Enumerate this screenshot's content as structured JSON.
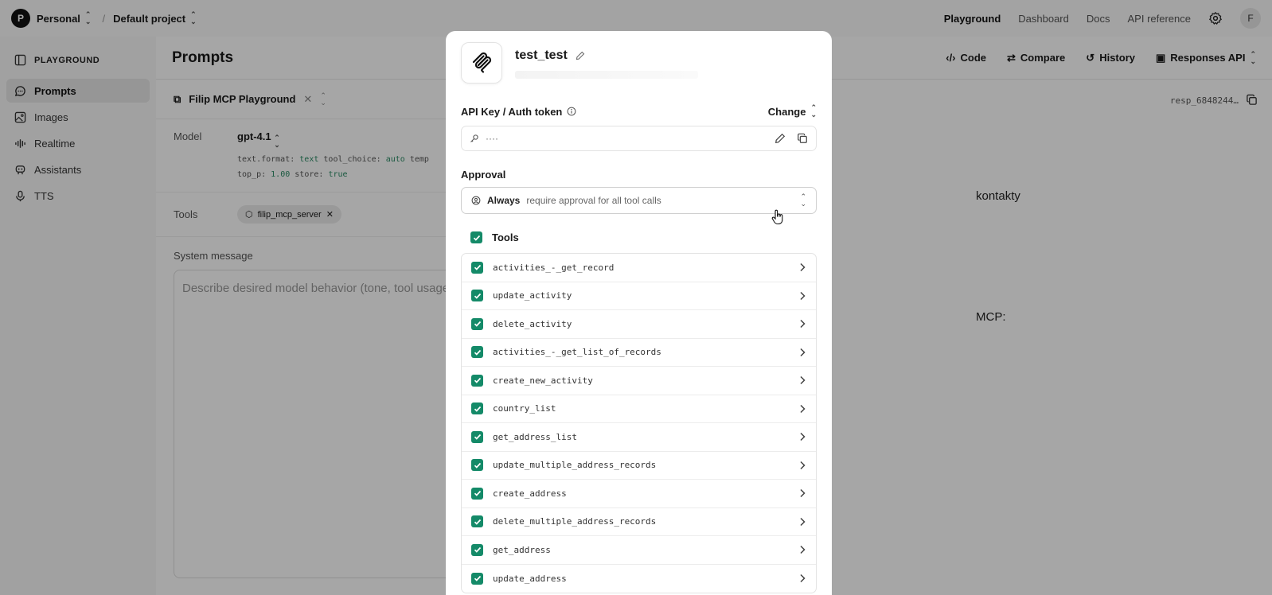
{
  "topbar": {
    "org_initial": "P",
    "org": "Personal",
    "project": "Default project",
    "nav": [
      "Playground",
      "Dashboard",
      "Docs",
      "API reference"
    ],
    "user_initial": "F"
  },
  "sidebar": {
    "section": "PLAYGROUND",
    "items": [
      {
        "label": "Prompts",
        "icon": "chat-bubble-icon"
      },
      {
        "label": "Images",
        "icon": "image-icon"
      },
      {
        "label": "Realtime",
        "icon": "waveform-icon"
      },
      {
        "label": "Assistants",
        "icon": "robot-icon"
      },
      {
        "label": "TTS",
        "icon": "microphone-icon"
      }
    ]
  },
  "main": {
    "title": "Prompts",
    "actions": [
      "Code",
      "Compare",
      "History",
      "Responses API"
    ],
    "prompt_name": "Filip MCP Playground",
    "model_label": "Model",
    "model": "gpt-4.1",
    "params_line1": {
      "k1": "text.format:",
      "v1": "text",
      "k2": "tool_choice:",
      "v2": "auto",
      "k3": "temp"
    },
    "params_line2": {
      "k1": "top_p:",
      "v1": "1.00",
      "k2": "store:",
      "v2": "true"
    },
    "tools_label": "Tools",
    "tool_chip": "filip_mcp_server",
    "system_label": "System message",
    "system_placeholder": "Describe desired model behavior (tone, tool usage",
    "response_id": "resp_6848244…",
    "right_text1": "kontakty",
    "right_text2": "MCP:"
  },
  "modal": {
    "title": "test_test",
    "api_key_label": "API Key / Auth token",
    "change_label": "Change",
    "api_key_value": "····",
    "approval_label": "Approval",
    "approval_strong": "Always",
    "approval_rest": "require approval for all tool calls",
    "tools_label": "Tools",
    "tools": [
      "activities_-_get_record",
      "update_activity",
      "delete_activity",
      "activities_-_get_list_of_records",
      "create_new_activity",
      "country_list",
      "get_address_list",
      "update_multiple_address_records",
      "create_address",
      "delete_multiple_address_records",
      "get_address",
      "update_address"
    ]
  },
  "colors": {
    "accent_check": "#148a68",
    "param_value": "#2a8a64"
  }
}
